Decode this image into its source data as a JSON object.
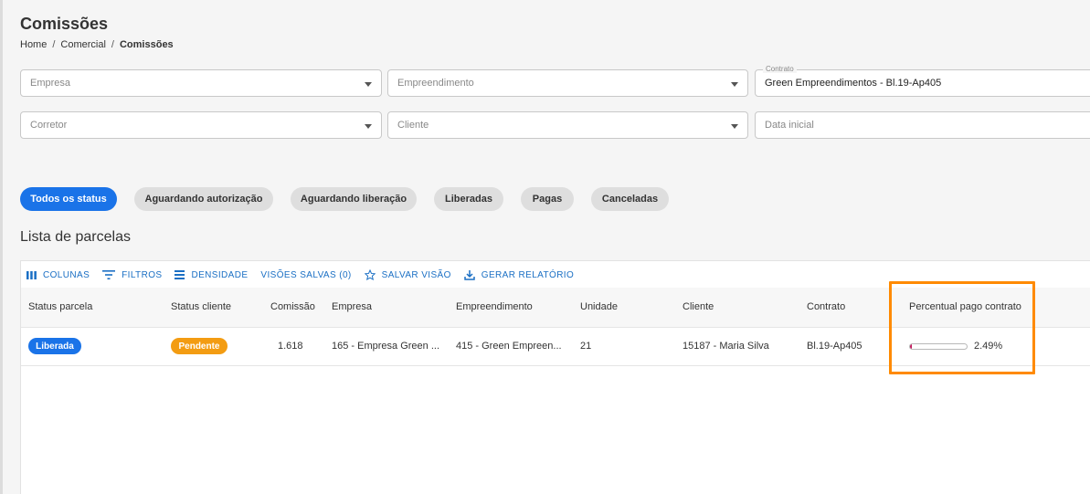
{
  "page": {
    "title": "Comissões",
    "breadcrumb": [
      "Home",
      "Comercial",
      "Comissões"
    ]
  },
  "filters": {
    "empresa": {
      "placeholder": "Empresa"
    },
    "empreendimento": {
      "placeholder": "Empreendimento"
    },
    "contrato": {
      "label": "Contrato",
      "value": "Green Empreendimentos - Bl.19-Ap405"
    },
    "corretor": {
      "placeholder": "Corretor"
    },
    "cliente": {
      "placeholder": "Cliente"
    },
    "data_inicial": {
      "placeholder": "Data inicial"
    }
  },
  "status_chips": [
    "Todos os status",
    "Aguardando autorização",
    "Aguardando liberação",
    "Liberadas",
    "Pagas",
    "Canceladas"
  ],
  "active_chip": "Todos os status",
  "section_title": "Lista de parcelas",
  "toolbar": {
    "colunas": "COLUNAS",
    "filtros": "FILTROS",
    "densidade": "DENSIDADE",
    "visoes_salvas": "VISÕES SALVAS (0)",
    "salvar_visao": "SALVAR VISÃO",
    "gerar_relatorio": "GERAR RELATÓRIO"
  },
  "table": {
    "columns": [
      "Status parcela",
      "Status cliente",
      "Comissão",
      "Empresa",
      "Empreendimento",
      "Unidade",
      "Cliente",
      "Contrato",
      "Percentual pago contrato"
    ],
    "rows": [
      {
        "status_parcela": "Liberada",
        "status_cliente": "Pendente",
        "comissao": "1.618",
        "empresa": "165 - Empresa Green ...",
        "empreendimento": "415 - Green Empreen...",
        "unidade": "21",
        "cliente": "15187 - Maria Silva",
        "contrato": "Bl.19-Ap405",
        "percentual_label": "2.49%",
        "percentual_value": 2.49
      }
    ]
  },
  "colors": {
    "primary": "#1a73e8",
    "pending": "#f39c12",
    "highlight": "#ff8a00",
    "progress_fill": "#c3185c"
  }
}
